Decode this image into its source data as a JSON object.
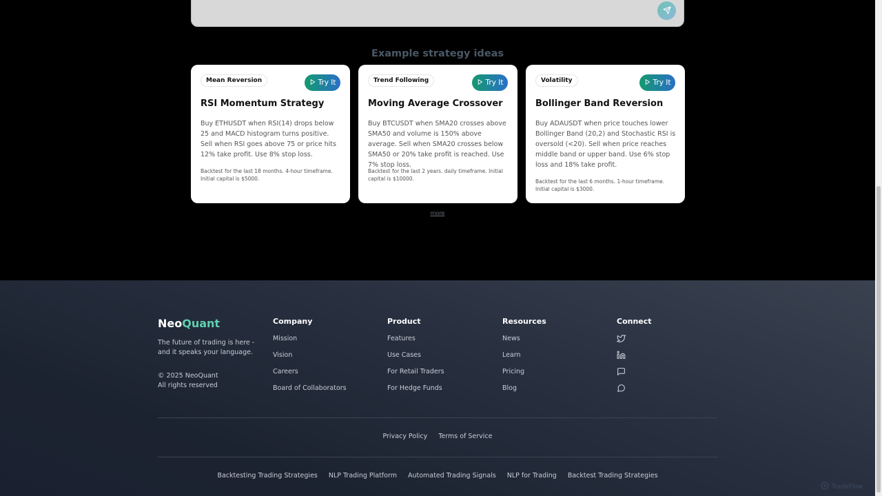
{
  "prompt": {
    "send_icon": "send-icon"
  },
  "examples": {
    "title": "Example strategy ideas",
    "try_label": "Try It",
    "more_label": "more",
    "cards": [
      {
        "badge": "Mean Reversion",
        "title": "RSI Momentum Strategy",
        "description": "Buy ETHUSDT when RSI(14) drops below 25 and MACD histogram turns positive. Sell when RSI goes above 75 or price hits 12% take profit. Use 8% stop loss.",
        "note": "Backtest for the last 18 months. 4-hour timeframe. Initial capital is $5000."
      },
      {
        "badge": "Trend Following",
        "title": "Moving Average Crossover",
        "description": "Buy BTCUSDT when SMA20 crosses above SMA50 and volume is 150% above average. Sell when SMA20 crosses below SMA50 or 20% take profit is reached. Use 7% stop loss.",
        "note": "Backtest for the last 2 years. daily timeframe. Initial capital is $10000."
      },
      {
        "badge": "Volatility",
        "title": "Bollinger Band Reversion",
        "description": "Buy ADAUSDT when price touches lower Bollinger Band (20,2) and Stochastic RSI is oversold (<20). Sell when price reaches middle band or upper band. Use 6% stop loss and 18% take profit.",
        "note": "Backtest for the last 6 months. 1-hour timeframe. Initial capital is $3000."
      }
    ]
  },
  "footer": {
    "brand_neo": "Neo",
    "brand_quant": "Quant",
    "tagline": "The future of trading is here - and it speaks your language.",
    "copyright_line1": "© 2025 NeoQuant",
    "copyright_line2": "All rights reserved",
    "company": {
      "title": "Company",
      "items": [
        "Mission",
        "Vision",
        "Careers",
        "Board of Collaborators"
      ]
    },
    "product": {
      "title": "Product",
      "items": [
        "Features",
        "Use Cases",
        "For Retail Traders",
        "For Hedge Funds"
      ]
    },
    "resources": {
      "title": "Resources",
      "items": [
        "News",
        "Learn",
        "Pricing",
        "Blog"
      ]
    },
    "connect": {
      "title": "Connect",
      "icons": [
        "twitter-icon",
        "linkedin-icon",
        "message-square-icon",
        "message-circle-icon"
      ]
    },
    "legal": [
      "Privacy Policy",
      "Terms of Service"
    ],
    "seo_links": [
      "Backtesting Trading Strategies",
      "NLP Trading Platform",
      "Automated Trading Signals",
      "NLP for Trading",
      "Backtest Trading Strategies"
    ],
    "brand_color": "#5fd0b0"
  },
  "watermark": {
    "icon": "logo-icon",
    "text": "TradeFlow"
  }
}
